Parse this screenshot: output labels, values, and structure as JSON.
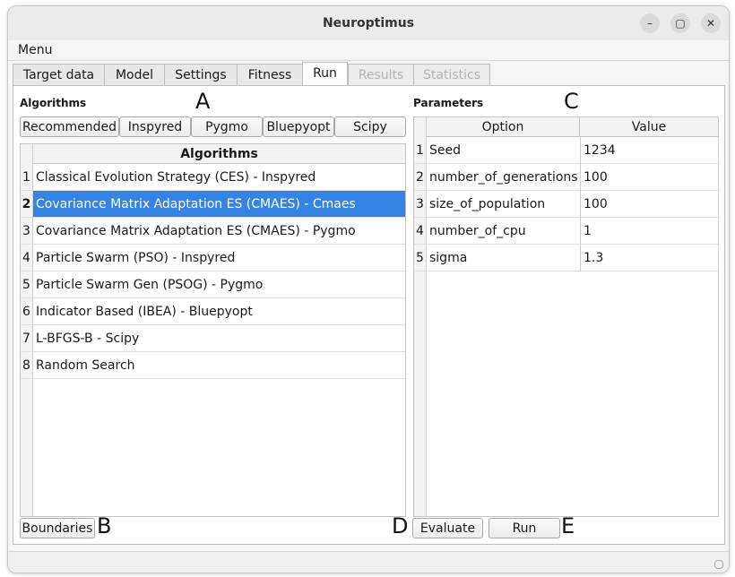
{
  "window": {
    "title": "Neuroptimus"
  },
  "window_controls": {
    "minimize": "–",
    "maximize": "▢",
    "close": "✕"
  },
  "menubar": {
    "menu_label": "Menu"
  },
  "tabs": [
    {
      "label": "Target data",
      "state": "normal"
    },
    {
      "label": "Model",
      "state": "normal"
    },
    {
      "label": "Settings",
      "state": "normal"
    },
    {
      "label": "Fitness",
      "state": "normal"
    },
    {
      "label": "Run",
      "state": "active"
    },
    {
      "label": "Results",
      "state": "disabled"
    },
    {
      "label": "Statistics",
      "state": "disabled"
    }
  ],
  "algorithms_panel": {
    "section_label": "Algorithms",
    "marker": "A",
    "filter_buttons": [
      "Recommended",
      "Inspyred",
      "Pygmo",
      "Bluepyopt",
      "Scipy"
    ],
    "table_header": "Algorithms",
    "rows": [
      {
        "num": "1",
        "label": "Classical Evolution Strategy (CES) - Inspyred"
      },
      {
        "num": "2",
        "label": "Covariance Matrix Adaptation ES (CMAES) - Cmaes",
        "selected": true
      },
      {
        "num": "3",
        "label": "Covariance Matrix Adaptation ES (CMAES) - Pygmo"
      },
      {
        "num": "4",
        "label": "Particle Swarm (PSO) - Inspyred"
      },
      {
        "num": "5",
        "label": "Particle Swarm Gen (PSOG) - Pygmo"
      },
      {
        "num": "6",
        "label": "Indicator Based (IBEA) - Bluepyopt"
      },
      {
        "num": "7",
        "label": "L-BFGS-B - Scipy"
      },
      {
        "num": "8",
        "label": "Random Search"
      }
    ]
  },
  "parameters_panel": {
    "section_label": "Parameters",
    "marker": "C",
    "columns": [
      "Option",
      "Value"
    ],
    "rows": [
      {
        "num": "1",
        "option": "Seed",
        "value": "1234"
      },
      {
        "num": "2",
        "option": "number_of_generations",
        "value": "100"
      },
      {
        "num": "3",
        "option": "size_of_population",
        "value": "100"
      },
      {
        "num": "4",
        "option": "number_of_cpu",
        "value": "1"
      },
      {
        "num": "5",
        "option": "sigma",
        "value": "1.3"
      }
    ]
  },
  "bottom_bar": {
    "boundaries_label": "Boundaries",
    "boundaries_marker": "B",
    "evaluate_marker": "D",
    "evaluate_label": "Evaluate",
    "run_label": "Run",
    "run_marker": "E"
  },
  "colors": {
    "selection": "#3584e4",
    "window_bg": "#f5f5f5"
  }
}
